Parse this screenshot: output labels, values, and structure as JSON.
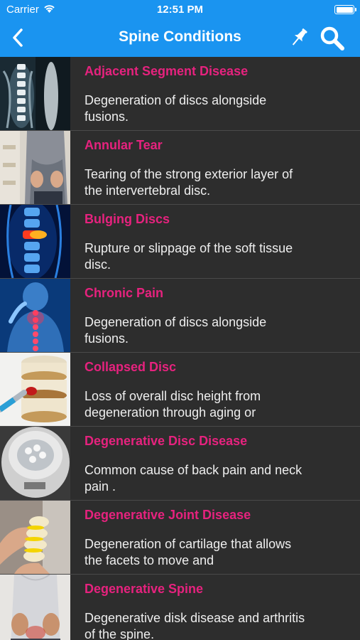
{
  "status_bar": {
    "carrier": "Carrier",
    "time": "12:51 PM"
  },
  "nav": {
    "title": "Spine Conditions",
    "back_icon": "chevron-left-icon",
    "pin_icon": "pin-icon",
    "search_icon": "search-icon"
  },
  "colors": {
    "nav_background": "#1a94f0",
    "list_background": "#2d2d2d",
    "title_accent": "#e6227e",
    "description_text": "#eeeeee"
  },
  "conditions": [
    {
      "title": "Adjacent Segment Disease",
      "description": "Degeneration of discs alongside fusions.",
      "thumbnail": "xray"
    },
    {
      "title": "Annular Tear",
      "description": "Tearing of the strong exterior layer of the intervertebral disc.",
      "thumbnail": "back"
    },
    {
      "title": "Bulging Discs",
      "description": "Rupture or slippage of the soft tissue disc.",
      "thumbnail": "blue-spine"
    },
    {
      "title": "Chronic Pain",
      "description": "Degeneration of discs alongside fusions.",
      "thumbnail": "neck-pain"
    },
    {
      "title": "Collapsed Disc",
      "description": "Loss of overall disc height from degeneration through aging or",
      "thumbnail": "disc-model"
    },
    {
      "title": "Degenerative Disc Disease",
      "description": "Common cause of back pain and neck pain .",
      "thumbnail": "disc-top"
    },
    {
      "title": "Degenerative Joint Disease",
      "description": "Degeneration of cartilage that allows the facets to move and",
      "thumbnail": "spine-model"
    },
    {
      "title": "Degenerative Spine",
      "description": "Degenerative disk disease and arthritis of the spine.",
      "thumbnail": "lower-back"
    }
  ]
}
